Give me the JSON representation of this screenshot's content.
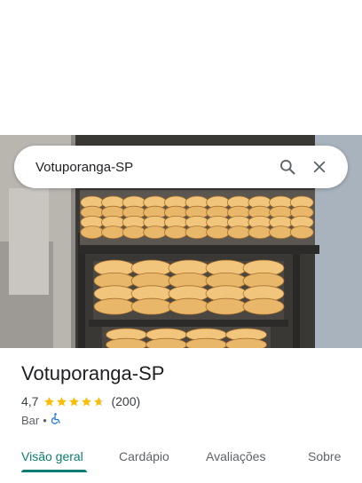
{
  "search": {
    "query": "Votuporanga-SP"
  },
  "place": {
    "name": "Votuporanga-SP",
    "rating": "4,7",
    "stars": 4.7,
    "review_count": "(200)",
    "category": "Bar",
    "separator": "•",
    "accessibility_icon": "wheelchair-icon"
  },
  "tabs": [
    {
      "label": "Visão geral",
      "active": true
    },
    {
      "label": "Cardápio",
      "active": false
    },
    {
      "label": "Avaliações",
      "active": false
    },
    {
      "label": "Sobre",
      "active": false
    }
  ],
  "colors": {
    "accent": "#0b7b73",
    "star": "#fbbc04",
    "wheelchair": "#1a73e8"
  },
  "icons": {
    "search": "search-icon",
    "close": "close-icon"
  }
}
